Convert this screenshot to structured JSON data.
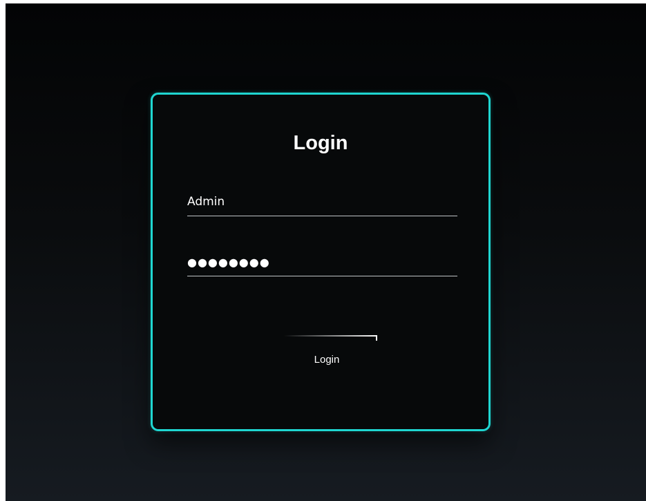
{
  "login_form": {
    "title": "Login",
    "username": {
      "value": "Admin"
    },
    "password": {
      "masked_value": "●●●●●●●●"
    },
    "submit": {
      "label": "Login"
    }
  },
  "colors": {
    "card_border": "#1fd6d1",
    "card_background": "#07090a",
    "text": "#ffffff",
    "field_underline": "#bfc3c6"
  }
}
